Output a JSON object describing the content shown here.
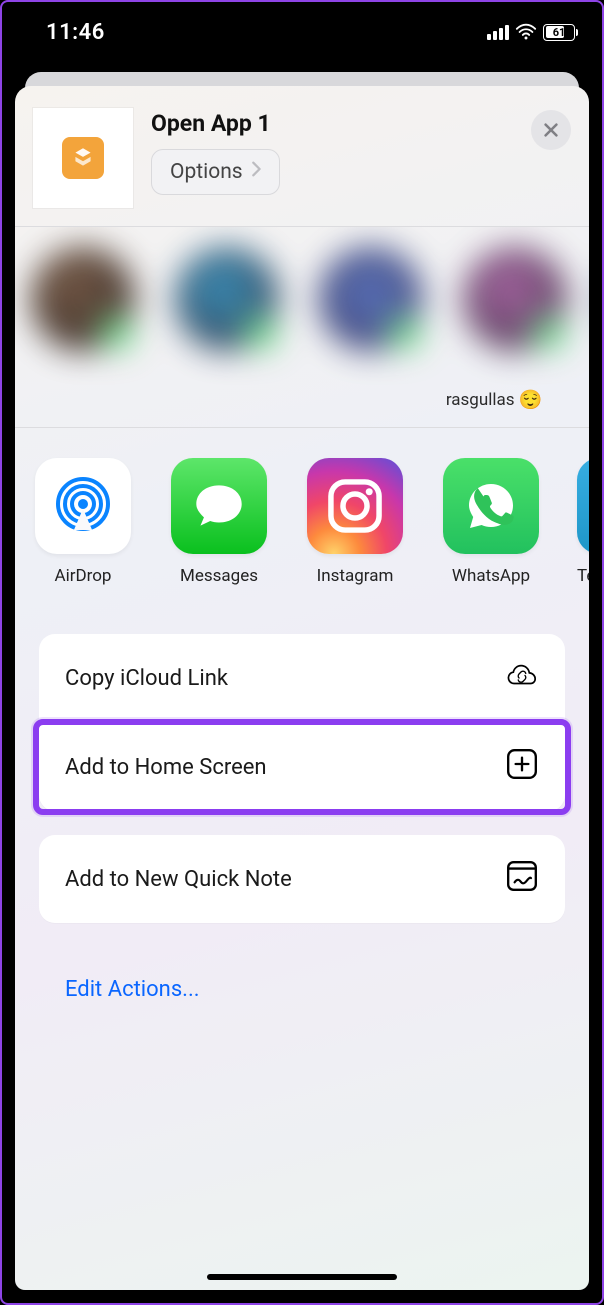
{
  "statusbar": {
    "time": "11:46",
    "battery": "61"
  },
  "header": {
    "title": "Open App 1",
    "options_label": "Options"
  },
  "contacts": {
    "caption": "rasgullas"
  },
  "apps": [
    {
      "key": "airdrop",
      "label": "AirDrop"
    },
    {
      "key": "messages",
      "label": "Messages"
    },
    {
      "key": "instagram",
      "label": "Instagram"
    },
    {
      "key": "whatsapp",
      "label": "WhatsApp"
    },
    {
      "key": "telegram",
      "label_partial": "Te"
    }
  ],
  "actions": {
    "copy_icloud": "Copy iCloud Link",
    "add_home_screen": "Add to Home Screen",
    "add_quick_note": "Add to New Quick Note"
  },
  "edit_actions": "Edit Actions..."
}
